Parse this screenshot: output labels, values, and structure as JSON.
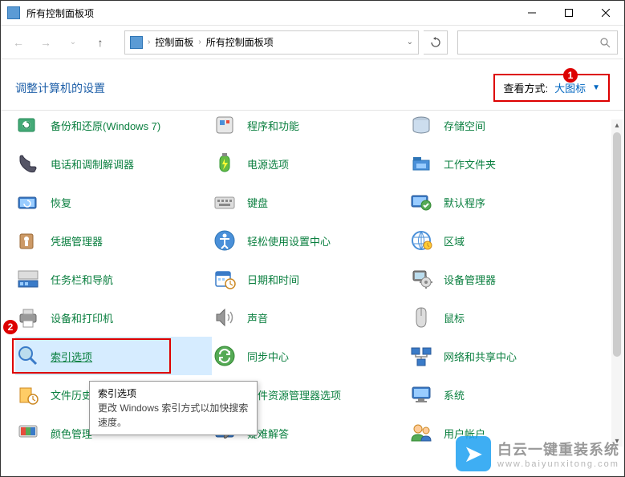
{
  "titlebar": {
    "title": "所有控制面板项"
  },
  "address": {
    "crumb1": "控制面板",
    "crumb2": "所有控制面板项"
  },
  "search": {
    "placeholder": ""
  },
  "subheader": {
    "title": "调整计算机的设置"
  },
  "viewmode": {
    "label": "查看方式:",
    "value": "大图标"
  },
  "annotations": {
    "a1": "1",
    "a2": "2"
  },
  "items": {
    "r0c0": "备份和还原(Windows 7)",
    "r0c1": "程序和功能",
    "r0c2": "存储空间",
    "r1c0": "电话和调制解调器",
    "r1c1": "电源选项",
    "r1c2": "工作文件夹",
    "r2c0": "恢复",
    "r2c1": "键盘",
    "r2c2": "默认程序",
    "r3c0": "凭据管理器",
    "r3c1": "轻松使用设置中心",
    "r3c2": "区域",
    "r4c0": "任务栏和导航",
    "r4c1": "日期和时间",
    "r4c2": "设备管理器",
    "r5c0": "设备和打印机",
    "r5c1": "声音",
    "r5c2": "鼠标",
    "r6c0": "索引选项",
    "r6c1": "同步中心",
    "r6c2": "网络和共享中心",
    "r7c0": "文件历史记录",
    "r7c1": "文件资源管理器选项",
    "r7c2": "系统",
    "r8c0": "颜色管理",
    "r8c1": "疑难解答",
    "r8c2": "用户帐户"
  },
  "tooltip": {
    "title": "索引选项",
    "body": "更改 Windows 索引方式以加快搜索速度。"
  },
  "watermark": {
    "main": "白云一键重装系统",
    "sub": "www.baiyunxitong.com"
  }
}
